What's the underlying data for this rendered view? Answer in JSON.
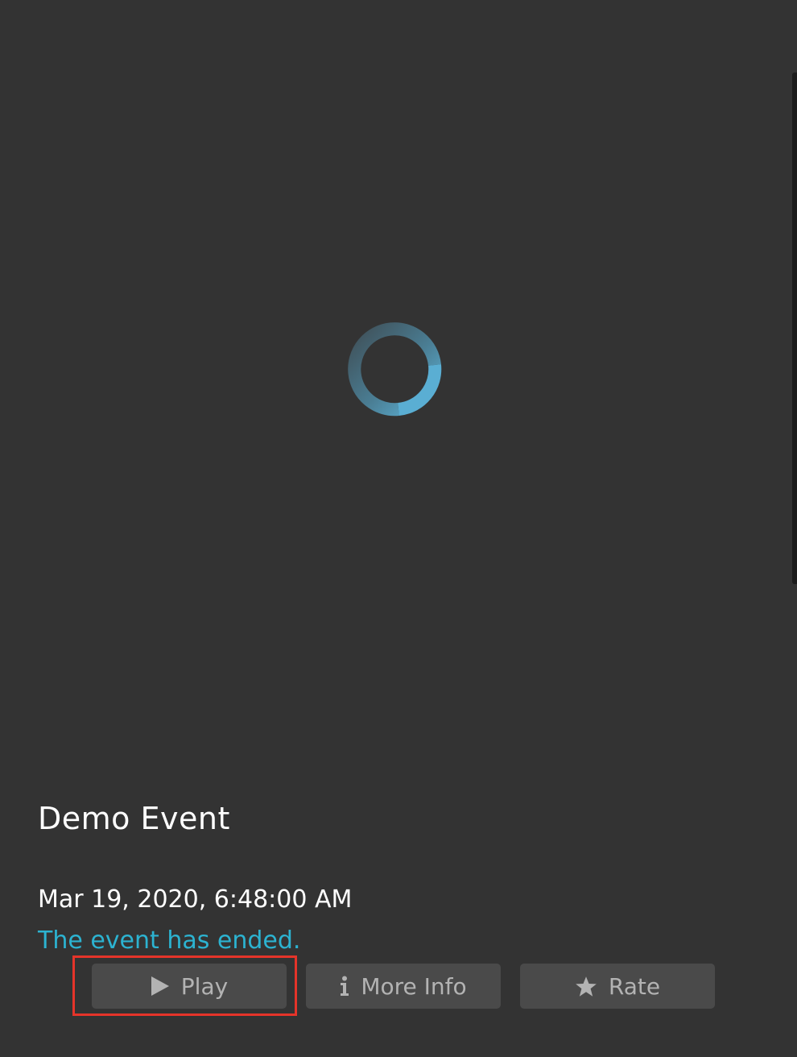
{
  "event": {
    "title": "Demo Event",
    "datetime": "Mar 19, 2020, 6:48:00 AM",
    "status": "The event has ended."
  },
  "actions": {
    "play_label": "Play",
    "more_info_label": "More Info",
    "rate_label": "Rate"
  },
  "icons": {
    "play": "play-icon",
    "info": "info-icon",
    "rate": "star-icon",
    "loading": "loading-spinner-icon"
  },
  "colors": {
    "background": "#333333",
    "status_text": "#2cb3d1",
    "button_bg": "#4a4a4a",
    "button_text": "#b3b3b3",
    "spinner": "#5aa9cc",
    "highlight": "#e5342a"
  }
}
